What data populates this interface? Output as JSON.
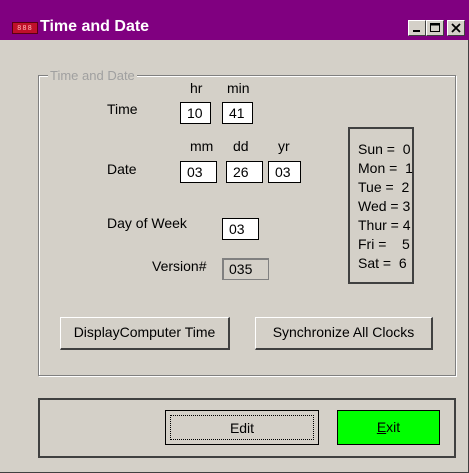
{
  "window": {
    "title": "Time and Date",
    "icon_name": "app-clock-icon"
  },
  "group": {
    "legend": "Time and Date"
  },
  "time": {
    "label": "Time",
    "hr_header": "hr",
    "min_header": "min",
    "hr_value": "10",
    "min_value": "41"
  },
  "date": {
    "label": "Date",
    "mm_header": "mm",
    "dd_header": "dd",
    "yr_header": "yr",
    "mm_value": "03",
    "dd_value": "26",
    "yr_value": "03"
  },
  "day_of_week": {
    "label": "Day of Week",
    "value": "03"
  },
  "version": {
    "label": "Version#",
    "value": "035"
  },
  "day_legend": [
    "Sun =  0",
    "Mon =  1",
    "Tue =  2",
    "Wed = 3",
    "Thur = 4",
    "Fri =    5",
    "Sat =  6"
  ],
  "buttons": {
    "display_computer_time": "DisplayComputer Time",
    "synchronize_all_clocks": "Synchronize All Clocks",
    "edit": "Edit",
    "exit_first": "E",
    "exit_rest": "xit"
  },
  "colors": {
    "titlebar": "#800080",
    "exit_button": "#00ff00",
    "face": "#d4d0c8"
  }
}
